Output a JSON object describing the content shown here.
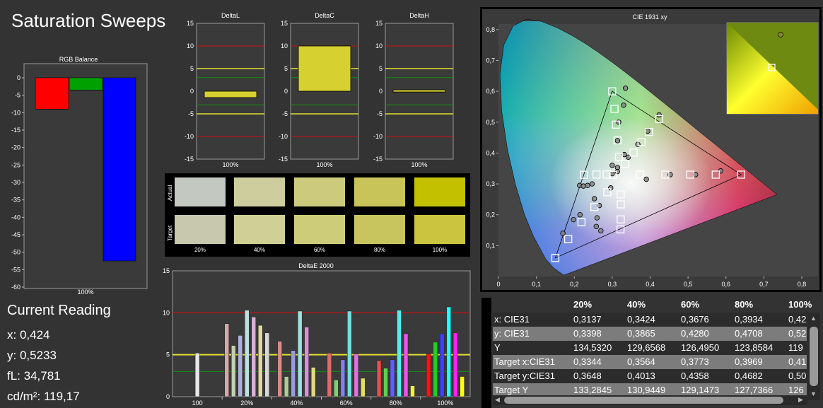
{
  "title": "Saturation Sweeps",
  "rgb_balance": {
    "title": "RGB Balance",
    "xlabel": "100%",
    "yticks": [
      "0",
      "-5",
      "-10",
      "-15",
      "-20",
      "-25",
      "-30",
      "-35",
      "-40",
      "-45",
      "-50",
      "-55",
      "-60"
    ],
    "ylim": [
      -60,
      0
    ],
    "bars": [
      {
        "name": "Red",
        "value": -9,
        "color": "#ff0000"
      },
      {
        "name": "Green",
        "value": -3.5,
        "color": "#00a000"
      },
      {
        "name": "Blue",
        "value": -52.5,
        "color": "#0000ff"
      }
    ]
  },
  "delta_charts": [
    {
      "title": "DeltaL",
      "xlabel": "100%",
      "value": -1.4
    },
    {
      "title": "DeltaC",
      "xlabel": "100%",
      "value": 10.0
    },
    {
      "title": "DeltaH",
      "xlabel": "100%",
      "value": 0.3
    }
  ],
  "delta_yticks": [
    "15",
    "10",
    "5",
    "0",
    "-5",
    "-10",
    "-15"
  ],
  "swatches": {
    "row_actual": "Actual",
    "row_target": "Target",
    "labels": [
      "20%",
      "40%",
      "60%",
      "80%",
      "100%"
    ],
    "actual_colors": [
      "#c3c9c1",
      "#cdcd9d",
      "#cccb7d",
      "#c8c45a",
      "#c3c000"
    ],
    "target_colors": [
      "#c8c8ae",
      "#cfcf96",
      "#cdcc78",
      "#c8c55e",
      "#cac43e"
    ]
  },
  "reading": {
    "title": "Current Reading",
    "x": "x: 0,424",
    "y": "y: 0,5233",
    "fl": "fL: 34,781",
    "cdm2": "cd/m²: 119,17"
  },
  "deltae": {
    "title": "DeltaE 2000",
    "yticks": [
      "15",
      "10",
      "5",
      "0"
    ],
    "categories": [
      "100",
      "20%",
      "40%",
      "60%",
      "80%",
      "100%"
    ],
    "series_colors": [
      "#ff0000",
      "#00c000",
      "#4040ff",
      "#00ffff",
      "#ff00ff",
      "#ffff00",
      "#ffffff"
    ]
  },
  "chart_data": [
    {
      "type": "bar",
      "title": "RGB Balance",
      "categories": [
        "100%"
      ],
      "series": [
        {
          "values": [
            -9
          ]
        },
        {
          "values": [
            -3.5
          ]
        },
        {
          "values": [
            -52.5
          ]
        }
      ],
      "ylim": [
        -60,
        0
      ]
    },
    {
      "type": "bar",
      "title": "DeltaL",
      "categories": [
        "100%"
      ],
      "values": [
        -1.4
      ],
      "ylim": [
        -15,
        15
      ]
    },
    {
      "type": "bar",
      "title": "DeltaC",
      "categories": [
        "100%"
      ],
      "values": [
        10.0
      ],
      "ylim": [
        -15,
        15
      ]
    },
    {
      "type": "bar",
      "title": "DeltaH",
      "categories": [
        "100%"
      ],
      "values": [
        0.3
      ],
      "ylim": [
        -15,
        15
      ]
    },
    {
      "type": "bar",
      "title": "DeltaE 2000",
      "categories": [
        "100",
        "20%",
        "40%",
        "60%",
        "80%",
        "100%"
      ],
      "ylim": [
        0,
        15
      ],
      "groups": [
        {
          "category": "100",
          "values": [
            5.2
          ]
        },
        {
          "category": "20%",
          "values": [
            8.7,
            6.1,
            7.3,
            10.3,
            9.5,
            8.5,
            7.6
          ]
        },
        {
          "category": "40%",
          "values": [
            6.6,
            2.4,
            5.5,
            10.2,
            8.3,
            3.5
          ]
        },
        {
          "category": "60%",
          "values": [
            5.2,
            2.0,
            4.4,
            10.2,
            5.1,
            2.2
          ]
        },
        {
          "category": "80%",
          "values": [
            4.3,
            3.4,
            4.4,
            10.3,
            7.5,
            1.3
          ]
        },
        {
          "category": "100%",
          "values": [
            5.1,
            6.5,
            7.5,
            10.7,
            7.6,
            2.4
          ]
        }
      ]
    },
    {
      "type": "scatter",
      "title": "CIE 1931 xy",
      "xlim": [
        0,
        0.8
      ],
      "ylim": [
        0,
        0.85
      ],
      "xticks": [
        "0",
        "0,1",
        "0,2",
        "0,3",
        "0,4",
        "0,5",
        "0,6",
        "0,7",
        "0,8"
      ],
      "yticks": [
        "0,1",
        "0,2",
        "0,3",
        "0,4",
        "0,5",
        "0,6",
        "0,7",
        "0,8"
      ],
      "gamut_triangle": [
        [
          0.64,
          0.33
        ],
        [
          0.3,
          0.6
        ],
        [
          0.15,
          0.06
        ]
      ],
      "targets": [
        [
          0.64,
          0.33
        ],
        [
          0.573,
          0.33
        ],
        [
          0.506,
          0.33
        ],
        [
          0.44,
          0.33
        ],
        [
          0.373,
          0.33
        ],
        [
          0.3,
          0.6
        ],
        [
          0.306,
          0.543
        ],
        [
          0.31,
          0.492
        ],
        [
          0.314,
          0.441
        ],
        [
          0.3178,
          0.3874
        ],
        [
          0.15,
          0.06
        ],
        [
          0.184,
          0.121
        ],
        [
          0.219,
          0.176
        ],
        [
          0.253,
          0.225
        ],
        [
          0.287,
          0.273
        ],
        [
          0.2254,
          0.3295
        ],
        [
          0.2585,
          0.3304
        ],
        [
          0.2853,
          0.3305
        ],
        [
          0.3024,
          0.3292
        ],
        [
          0.3224,
          0.2658
        ],
        [
          0.3225,
          0.2337
        ],
        [
          0.3224,
          0.1849
        ],
        [
          0.3219,
          0.1525
        ],
        [
          0.3344,
          0.3648
        ],
        [
          0.3564,
          0.4013
        ],
        [
          0.3773,
          0.4358
        ],
        [
          0.3969,
          0.4682
        ],
        [
          0.424,
          0.51
        ]
      ],
      "measured": [
        [
          0.586,
          0.342
        ],
        [
          0.52,
          0.33
        ],
        [
          0.453,
          0.33
        ],
        [
          0.39,
          0.315
        ],
        [
          0.332,
          0.395
        ],
        [
          0.335,
          0.61
        ],
        [
          0.33,
          0.555
        ],
        [
          0.317,
          0.5
        ],
        [
          0.314,
          0.44
        ],
        [
          0.3,
          0.36
        ],
        [
          0.17,
          0.14
        ],
        [
          0.198,
          0.184
        ],
        [
          0.215,
          0.2
        ],
        [
          0.253,
          0.252
        ],
        [
          0.296,
          0.287
        ],
        [
          0.214,
          0.295
        ],
        [
          0.224,
          0.293
        ],
        [
          0.235,
          0.295
        ],
        [
          0.247,
          0.3
        ],
        [
          0.3,
          0.333
        ],
        [
          0.266,
          0.23
        ],
        [
          0.26,
          0.19
        ],
        [
          0.258,
          0.162
        ],
        [
          0.27,
          0.148
        ],
        [
          0.314,
          0.353
        ],
        [
          0.3137,
          0.3398
        ],
        [
          0.3424,
          0.3865
        ],
        [
          0.3676,
          0.428
        ],
        [
          0.3934,
          0.4708
        ],
        [
          0.4237,
          0.5233
        ]
      ]
    },
    {
      "type": "table",
      "columns": [
        "20%",
        "40%",
        "60%",
        "80%",
        "100%"
      ],
      "rows": [
        {
          "label": "x: CIE31",
          "values": [
            "0,3137",
            "0,3424",
            "0,3676",
            "0,3934",
            "0,42"
          ]
        },
        {
          "label": "y: CIE31",
          "values": [
            "0,3398",
            "0,3865",
            "0,4280",
            "0,4708",
            "0,52"
          ]
        },
        {
          "label": "Y",
          "values": [
            "134,5320",
            "129,6568",
            "126,4950",
            "123,8584",
            "119"
          ]
        },
        {
          "label": "Target x:CIE31",
          "values": [
            "0,3344",
            "0,3564",
            "0,3773",
            "0,3969",
            "0,41"
          ]
        },
        {
          "label": "Target y:CIE31",
          "values": [
            "0,3648",
            "0,4013",
            "0,4358",
            "0,4682",
            "0,50"
          ]
        },
        {
          "label": "Target Y",
          "values": [
            "133,2845",
            "130,9449",
            "129,1473",
            "127,7366",
            "126"
          ]
        }
      ]
    }
  ],
  "cie": {
    "title": "CIE 1931 xy"
  },
  "table": {
    "columns": [
      "20%",
      "40%",
      "60%",
      "80%",
      "100%"
    ],
    "rows": [
      {
        "label": "x: CIE31",
        "values": [
          "0,3137",
          "0,3424",
          "0,3676",
          "0,3934",
          "0,42"
        ]
      },
      {
        "label": "y: CIE31",
        "values": [
          "0,3398",
          "0,3865",
          "0,4280",
          "0,4708",
          "0,52"
        ]
      },
      {
        "label": "Y",
        "values": [
          "134,5320",
          "129,6568",
          "126,4950",
          "123,8584",
          "119"
        ]
      },
      {
        "label": "Target x:CIE31",
        "values": [
          "0,3344",
          "0,3564",
          "0,3773",
          "0,3969",
          "0,41"
        ]
      },
      {
        "label": "Target y:CIE31",
        "values": [
          "0,3648",
          "0,4013",
          "0,4358",
          "0,4682",
          "0,50"
        ]
      },
      {
        "label": "Target Y",
        "values": [
          "133,2845",
          "130,9449",
          "129,1473",
          "127,7366",
          "126"
        ]
      }
    ]
  }
}
